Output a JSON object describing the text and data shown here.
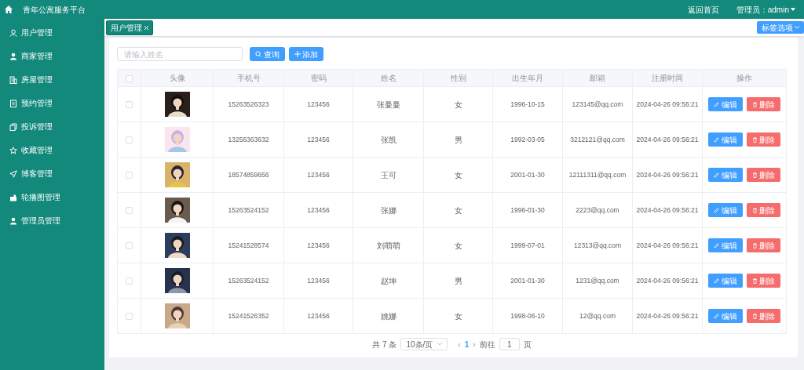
{
  "header": {
    "title": "青年公寓服务平台",
    "home_link": "返回首页",
    "user": "管理员：admin"
  },
  "sidebar": {
    "items": [
      {
        "label": "用户管理",
        "selected": false
      },
      {
        "label": "商家管理",
        "selected": false
      },
      {
        "label": "房屋管理",
        "selected": false
      },
      {
        "label": "预约管理",
        "selected": false
      },
      {
        "label": "投诉管理",
        "selected": false
      },
      {
        "label": "收藏管理",
        "selected": false
      },
      {
        "label": "博客管理",
        "selected": false
      },
      {
        "label": "轮播图管理",
        "selected": false
      },
      {
        "label": "管理员管理",
        "selected": false
      }
    ]
  },
  "tabs": [
    {
      "label": "用户管理",
      "selected": true
    }
  ],
  "tab_options": "标签选项",
  "search": {
    "placeholder": "请输入姓名"
  },
  "toolbar": {
    "query": "查询",
    "add": "添加"
  },
  "table": {
    "header_checked": false,
    "columns": [
      "头像",
      "手机号",
      "密码",
      "姓名",
      "性别",
      "出生年月",
      "邮箱",
      "注册时间",
      "操作"
    ],
    "rows": [
      {
        "checked": false,
        "phone": "15263526323",
        "password": "123456",
        "name": "张曼曼",
        "gender": "女",
        "birth": "1996-10-15",
        "email": "123145@qq.com",
        "registered": "2024-04-26 09:56:21",
        "edit": "编辑",
        "delete": "删除"
      },
      {
        "checked": false,
        "phone": "13256363632",
        "password": "123456",
        "name": "张凯",
        "gender": "男",
        "birth": "1992-03-05",
        "email": "3212121@qq.com",
        "registered": "2024-04-26 09:56:21",
        "edit": "编辑",
        "delete": "删除"
      },
      {
        "checked": false,
        "phone": "18574859656",
        "password": "123456",
        "name": "王可",
        "gender": "女",
        "birth": "2001-01-30",
        "email": "12111311@qq.com",
        "registered": "2024-04-26 09:56:21",
        "edit": "编辑",
        "delete": "删除"
      },
      {
        "checked": false,
        "phone": "15263524152",
        "password": "123456",
        "name": "张娜",
        "gender": "女",
        "birth": "1996-01-30",
        "email": "2223@qq.com",
        "registered": "2024-04-26 09:56:21",
        "edit": "编辑",
        "delete": "删除"
      },
      {
        "checked": false,
        "phone": "15241528574",
        "password": "123456",
        "name": "刘萌萌",
        "gender": "女",
        "birth": "1999-07-01",
        "email": "12313@qq.com",
        "registered": "2024-04-26 09:56:21",
        "edit": "编辑",
        "delete": "删除"
      },
      {
        "checked": false,
        "phone": "15263524152",
        "password": "123456",
        "name": "赵坤",
        "gender": "男",
        "birth": "2001-01-30",
        "email": "1231@qq.com",
        "registered": "2024-04-26 09:56:21",
        "edit": "编辑",
        "delete": "删除"
      },
      {
        "checked": false,
        "phone": "15241526352",
        "password": "123456",
        "name": "姚娜",
        "gender": "女",
        "birth": "1998-06-10",
        "email": "12@qq.com",
        "registered": "2024-04-26 09:56:21",
        "edit": "编辑",
        "delete": "删除"
      }
    ]
  },
  "pagination": {
    "total": "共 7 条",
    "page_size": "10条/页",
    "prev": "‹",
    "pages": [
      {
        "label": "1",
        "selected": true
      }
    ],
    "next": "›",
    "goto_label": "前往",
    "goto_value": "1",
    "goto_suffix": "页"
  }
}
